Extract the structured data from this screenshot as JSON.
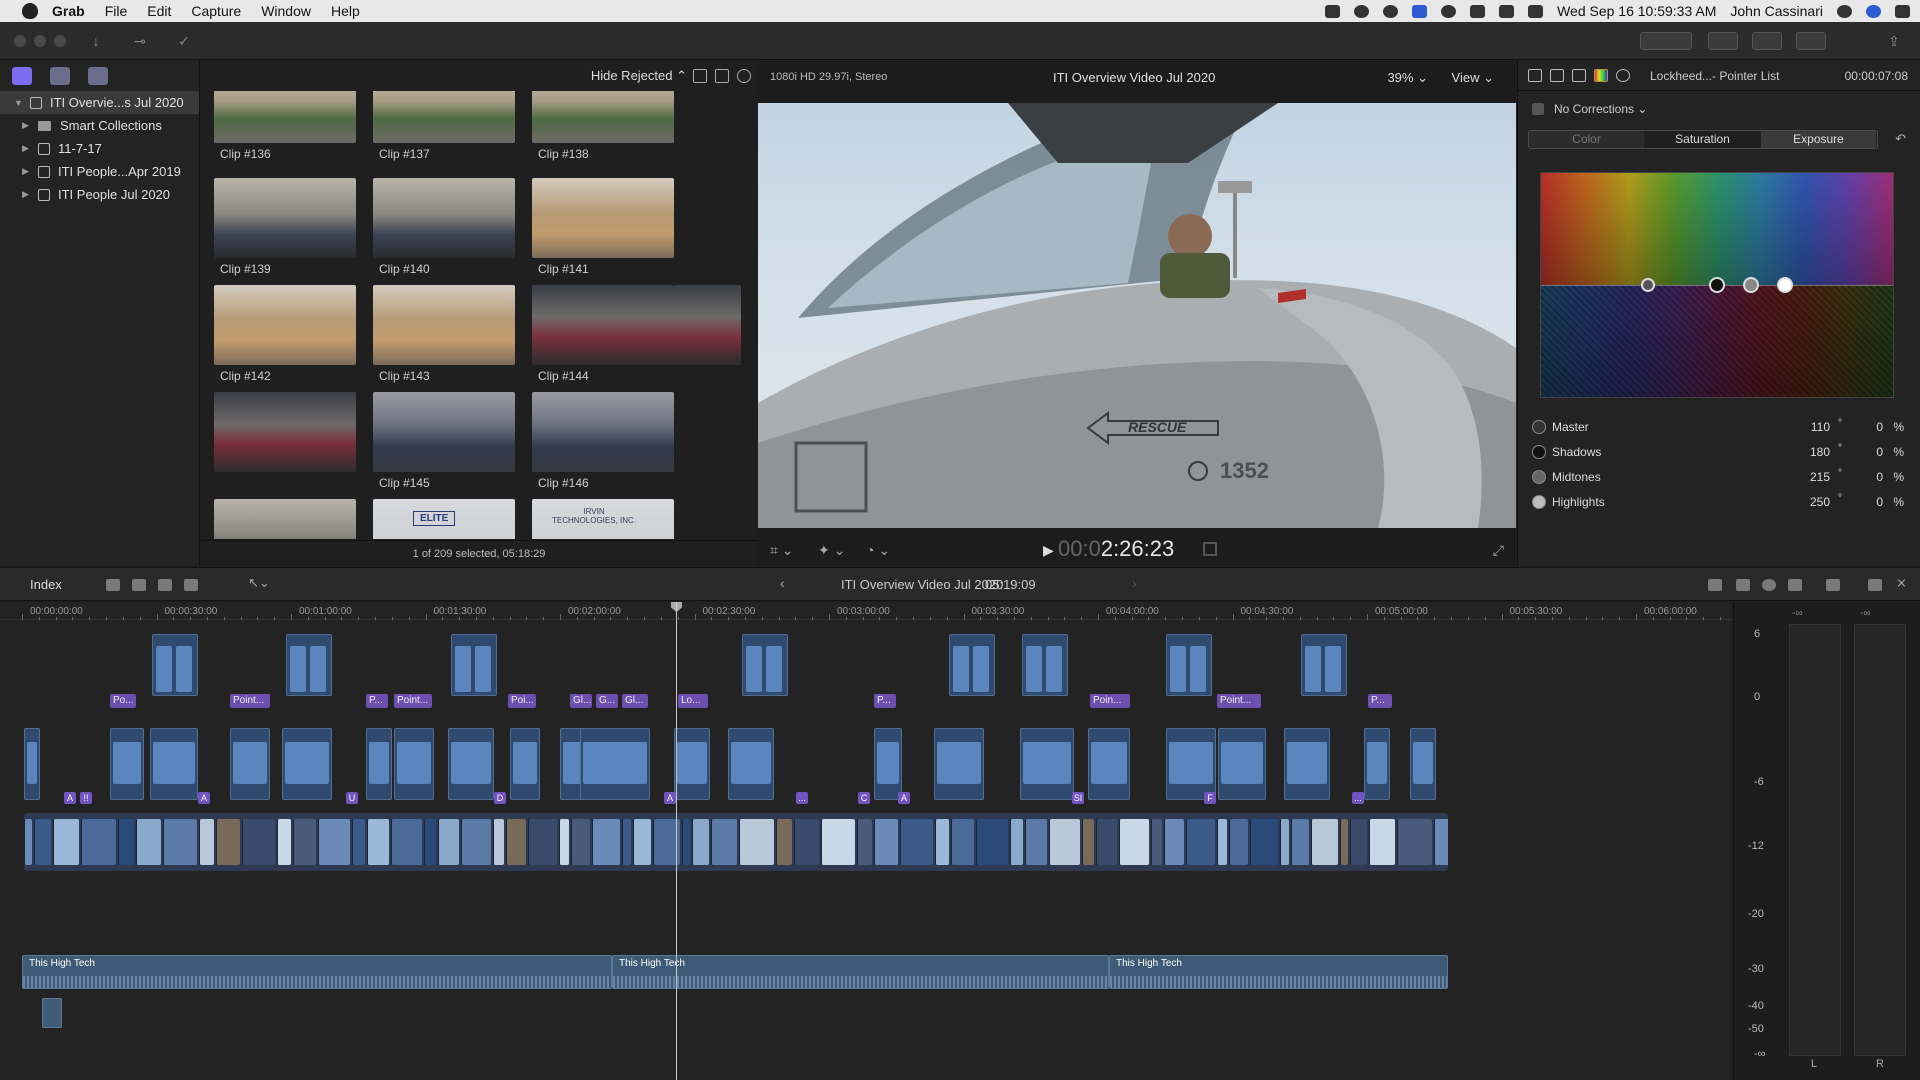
{
  "menubar": {
    "app": "Grab",
    "menus": [
      "File",
      "Edit",
      "Capture",
      "Window",
      "Help"
    ],
    "clock": "Wed Sep 16  10:59:33 AM",
    "user": "John Cassinari"
  },
  "libraries": {
    "items": [
      {
        "label": "ITI Overvie...s Jul 2020",
        "selected": true,
        "expanded": true
      },
      {
        "label": "Smart Collections"
      },
      {
        "label": "11-7-17"
      },
      {
        "label": "ITI People...Apr 2019"
      },
      {
        "label": "ITI People Jul 2020"
      }
    ]
  },
  "browser": {
    "filter": "Hide Rejected",
    "status": "1 of 209 selected, 05:18:29",
    "clips": [
      {
        "name": "Clip #136",
        "tone": "warehouse"
      },
      {
        "name": "Clip #137",
        "tone": "warehouse"
      },
      {
        "name": "Clip #138",
        "tone": "warehouse"
      },
      {
        "name": "Clip #139",
        "tone": "office"
      },
      {
        "name": "Clip #140",
        "tone": "office"
      },
      {
        "name": "Clip #141",
        "tone": "boxes"
      },
      {
        "name": "Clip #142",
        "tone": "boxes"
      },
      {
        "name": "Clip #143",
        "tone": "boxes"
      },
      {
        "name": "Clip #144",
        "tone": "desk"
      },
      {
        "name": "",
        "tone": "desk"
      },
      {
        "name": "Clip #145",
        "tone": "lab"
      },
      {
        "name": "Clip #146",
        "tone": "lab"
      },
      {
        "name": "",
        "tone": "office"
      },
      {
        "name": "",
        "tone": "sign"
      },
      {
        "name": "",
        "tone": "sign"
      }
    ],
    "thumb_text": [
      "ELITE",
      "IRVIN\nTECHNOLOGIES, INC."
    ]
  },
  "viewer": {
    "format": "1080i HD 29.97i, Stereo",
    "title": "ITI Overview Video Jul 2020",
    "zoom": "39%",
    "view": "View",
    "timecode_dim": "00:0",
    "timecode": "2:26:23",
    "image_text": {
      "rescue": "RESCUE",
      "tail_number": "1352"
    }
  },
  "inspector": {
    "title": "Lockheed...- Pointer List",
    "time": "00:00:07:08",
    "corrections": "No Corrections",
    "tabs": [
      "Color",
      "Saturation",
      "Exposure"
    ],
    "rows": [
      {
        "label": "Master",
        "degrees": "110",
        "percent": "0"
      },
      {
        "label": "Shadows",
        "degrees": "180",
        "percent": "0"
      },
      {
        "label": "Midtones",
        "degrees": "215",
        "percent": "0"
      },
      {
        "label": "Highlights",
        "degrees": "250",
        "percent": "0"
      }
    ],
    "degree_unit": "°",
    "percent_unit": "%"
  },
  "timeline": {
    "index_label": "Index",
    "title": "ITI Overview Video Jul 2020",
    "duration": "05:19:09",
    "ruler": [
      "00:00:00:00",
      "00:00:30:00",
      "00:01:00:00",
      "00:01:30:00",
      "00:02:00:00",
      "00:02:30:00",
      "00:03:00:00",
      "00:03:30:00",
      "00:04:00:00",
      "00:04:30:00",
      "00:05:00:00",
      "00:05:30:00",
      "00:06:00:00"
    ],
    "titles": [
      "Po...",
      "Point...",
      "P...",
      "Point...",
      "Poi...",
      "Gl...",
      "G...",
      "Gl...",
      "Lo...",
      "P...",
      "Poin...",
      "Point...",
      "P..."
    ],
    "music_label": "This High Tech"
  },
  "meters": {
    "db_scale": [
      "6",
      "0",
      "-6",
      "-12",
      "-20",
      "-30",
      "-40",
      "-50",
      "-∞"
    ],
    "peak_left": "-∞",
    "peak_right": "-∞",
    "channels": [
      "L",
      "R"
    ]
  },
  "colors": {
    "accent": "#7253c2",
    "storyline": "#2d3a52",
    "audio": "#3e5a76"
  }
}
